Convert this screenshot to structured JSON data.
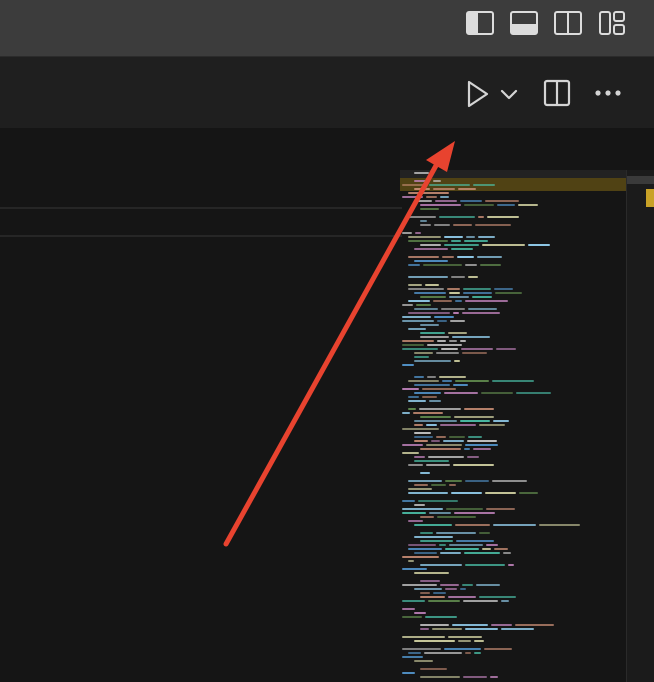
{
  "titlebar": {
    "layout_icons": [
      "toggle-primary-sidebar-icon",
      "toggle-panel-icon",
      "toggle-secondary-sidebar-icon",
      "customize-layout-icon"
    ]
  },
  "editor_toolbar": {
    "icons": [
      "run-icon",
      "run-dropdown-chevron-icon",
      "split-editor-icon",
      "more-actions-icon"
    ]
  },
  "annotation": {
    "color": "#e8432f"
  },
  "colors": {
    "titlebar": "#3c3c3c",
    "toolbar": "#1f1f1f",
    "editor": "#151515",
    "minimap_highlight": "#5a4a14",
    "scroll_marker": "#c9a227"
  }
}
